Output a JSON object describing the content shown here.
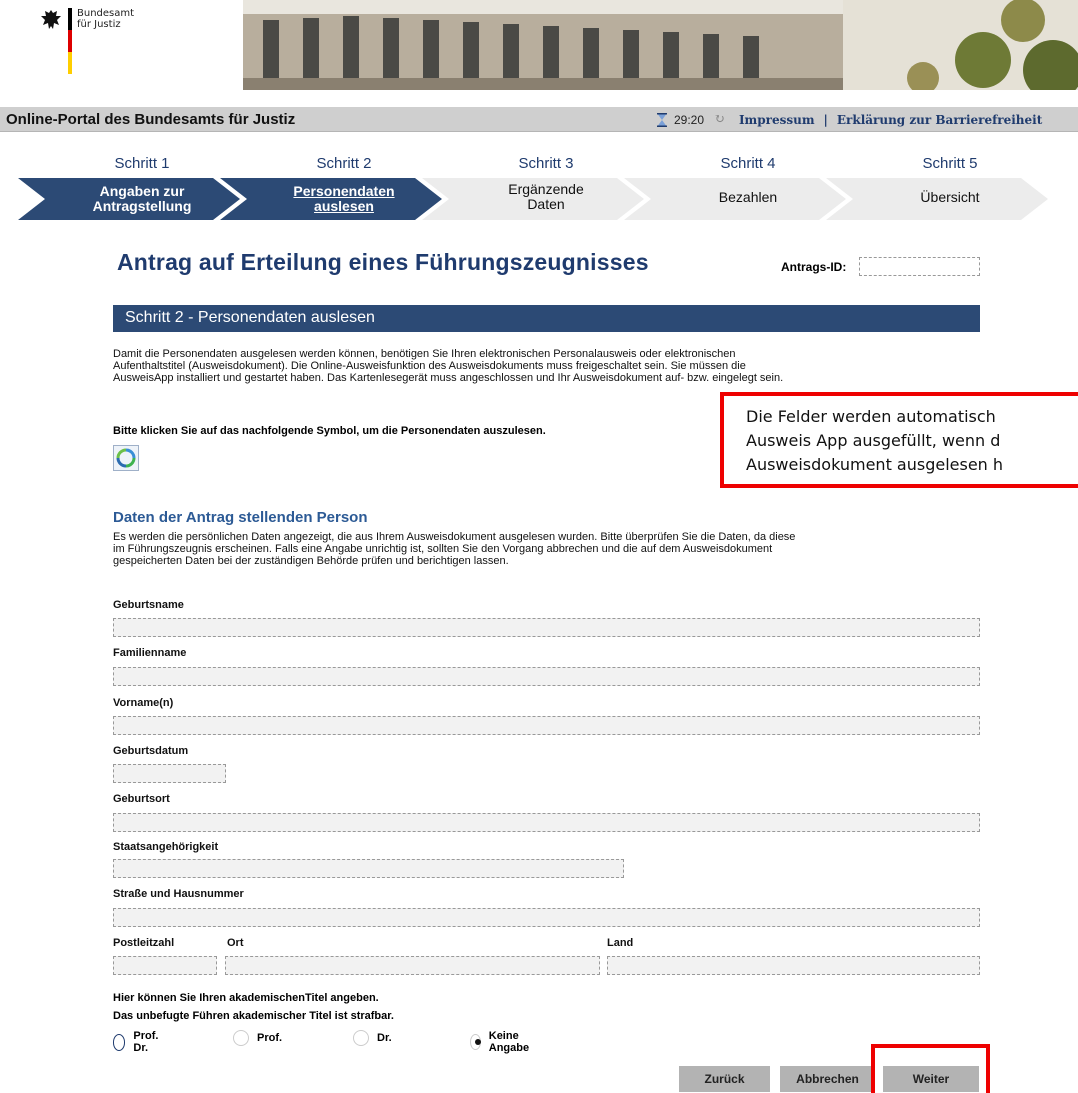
{
  "header": {
    "org_line1": "Bundesamt",
    "org_line2": "für Justiz"
  },
  "portal": {
    "title": "Online-Portal des Bundesamts für Justiz",
    "timer": "29:20",
    "impressum": "Impressum",
    "separator": "|",
    "barrierefreiheit": "Erklärung zur Barrierefreiheit"
  },
  "steps": [
    {
      "label": "Schritt 1",
      "line1": "Angaben zur",
      "line2": "Antragstellung",
      "state": "done"
    },
    {
      "label": "Schritt 2",
      "line1": "Personendaten",
      "line2": "auslesen",
      "state": "active"
    },
    {
      "label": "Schritt 3",
      "line1": "Ergänzende",
      "line2": "Daten",
      "state": "todo"
    },
    {
      "label": "Schritt 4",
      "line1": "Bezahlen",
      "line2": "",
      "state": "todo"
    },
    {
      "label": "Schritt 5",
      "line1": "Übersicht",
      "line2": "",
      "state": "todo"
    }
  ],
  "main": {
    "title": "Antrag auf Erteilung eines Führungszeugnisses",
    "antrags_id_label": "Antrags-ID:",
    "antrags_id_value": "",
    "section_title": "Schritt 2 - Personendaten auslesen",
    "intro_l1": "Damit die Personendaten ausgelesen werden können, benötigen Sie Ihren elektronischen Personalausweis oder elektronischen",
    "intro_l2": "Aufenthaltstitel (Ausweisdokument). Die Online-Ausweisfunktion des Ausweisdokuments muss freigeschaltet sein. Sie müssen die",
    "intro_l3": "AusweisApp installiert und gestartet haben. Das Kartenlesegerät muss angeschlossen und Ihr Ausweisdokument auf- bzw. eingelegt sein.",
    "click_hint": "Bitte klicken Sie auf das nachfolgende Symbol, um die Personendaten auszulesen.",
    "callout_l1": "Die Felder werden automatisch",
    "callout_l2": "Ausweis App ausgefüllt, wenn d",
    "callout_l3": "Ausweisdokument ausgelesen h",
    "person_title": "Daten der Antrag stellenden Person",
    "person_l1": "Es werden die persönlichen Daten angezeigt, die aus Ihrem Ausweisdokument ausgelesen wurden. Bitte überprüfen Sie die Daten, da diese",
    "person_l2": "im Führungszeugnis erscheinen. Falls eine Angabe unrichtig ist, sollten Sie den Vorgang abbrechen und die auf dem Ausweisdokument",
    "person_l3": "gespeicherten Daten bei der zuständigen Behörde prüfen und berichtigen lassen."
  },
  "fields": {
    "geburtsname": {
      "label": "Geburtsname",
      "value": ""
    },
    "familienname": {
      "label": "Familienname",
      "value": ""
    },
    "vorname": {
      "label": "Vorname(n)",
      "value": ""
    },
    "geburtsdatum": {
      "label": "Geburtsdatum",
      "value": ""
    },
    "geburtsort": {
      "label": "Geburtsort",
      "value": ""
    },
    "staatsangehoerigkeit": {
      "label": "Staatsangehörigkeit",
      "value": ""
    },
    "strasse": {
      "label": "Straße und Hausnummer",
      "value": ""
    },
    "plz": {
      "label": "Postleitzahl",
      "value": ""
    },
    "ort": {
      "label": "Ort",
      "value": ""
    },
    "land": {
      "label": "Land",
      "value": ""
    }
  },
  "titel": {
    "note1": "Hier können Sie Ihren akademischenTitel angeben.",
    "note2": "Das unbefugte Führen akademischer Titel ist strafbar.",
    "options": [
      "Prof. Dr.",
      "Prof.",
      "Dr.",
      "Keine Angabe"
    ],
    "selected": "Keine Angabe"
  },
  "buttons": {
    "back": "Zurück",
    "cancel": "Abbrechen",
    "next": "Weiter"
  },
  "colors": {
    "brand_blue": "#1f3b6e",
    "section_blue": "#2c4a75",
    "highlight_red": "#ee0000"
  }
}
